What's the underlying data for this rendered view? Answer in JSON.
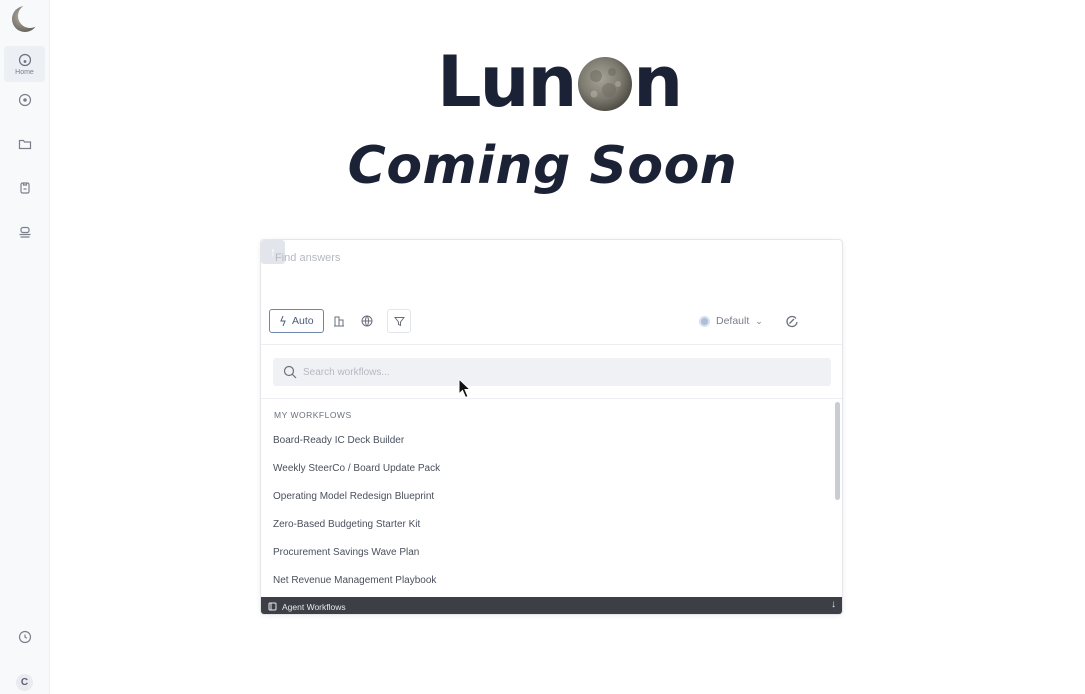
{
  "sidebar": {
    "items": [
      {
        "label": "Home",
        "icon": "home-icon"
      },
      {
        "label": "",
        "icon": "chat-icon"
      },
      {
        "label": "",
        "icon": "folder-icon"
      },
      {
        "label": "",
        "icon": "clipboard-icon"
      },
      {
        "label": "",
        "icon": "bot-icon"
      }
    ],
    "history_icon": "clock-icon",
    "avatar": "C"
  },
  "header": {
    "brand_pre": "Lun",
    "brand_post": "n",
    "coming": "Coming Soon"
  },
  "prompt": {
    "placeholder": "Find answers",
    "auto_label": "Auto",
    "default_label": "Default",
    "default_caret": "⌄"
  },
  "workflows": {
    "search_placeholder": "Search workflows...",
    "section_title": "MY WORKFLOWS",
    "items": [
      "Board-Ready IC Deck Builder",
      "Weekly SteerCo / Board Update Pack",
      "Operating Model Redesign Blueprint",
      "Zero-Based Budgeting Starter Kit",
      "Procurement Savings Wave Plan",
      "Net Revenue Management Playbook"
    ],
    "footer_label": "Agent Workflows",
    "footer_arrow": "↓"
  },
  "colors": {
    "brand_navy": "#1c2236",
    "footer_bg": "#3c3f45",
    "accent_blue": "#6e86a8"
  }
}
